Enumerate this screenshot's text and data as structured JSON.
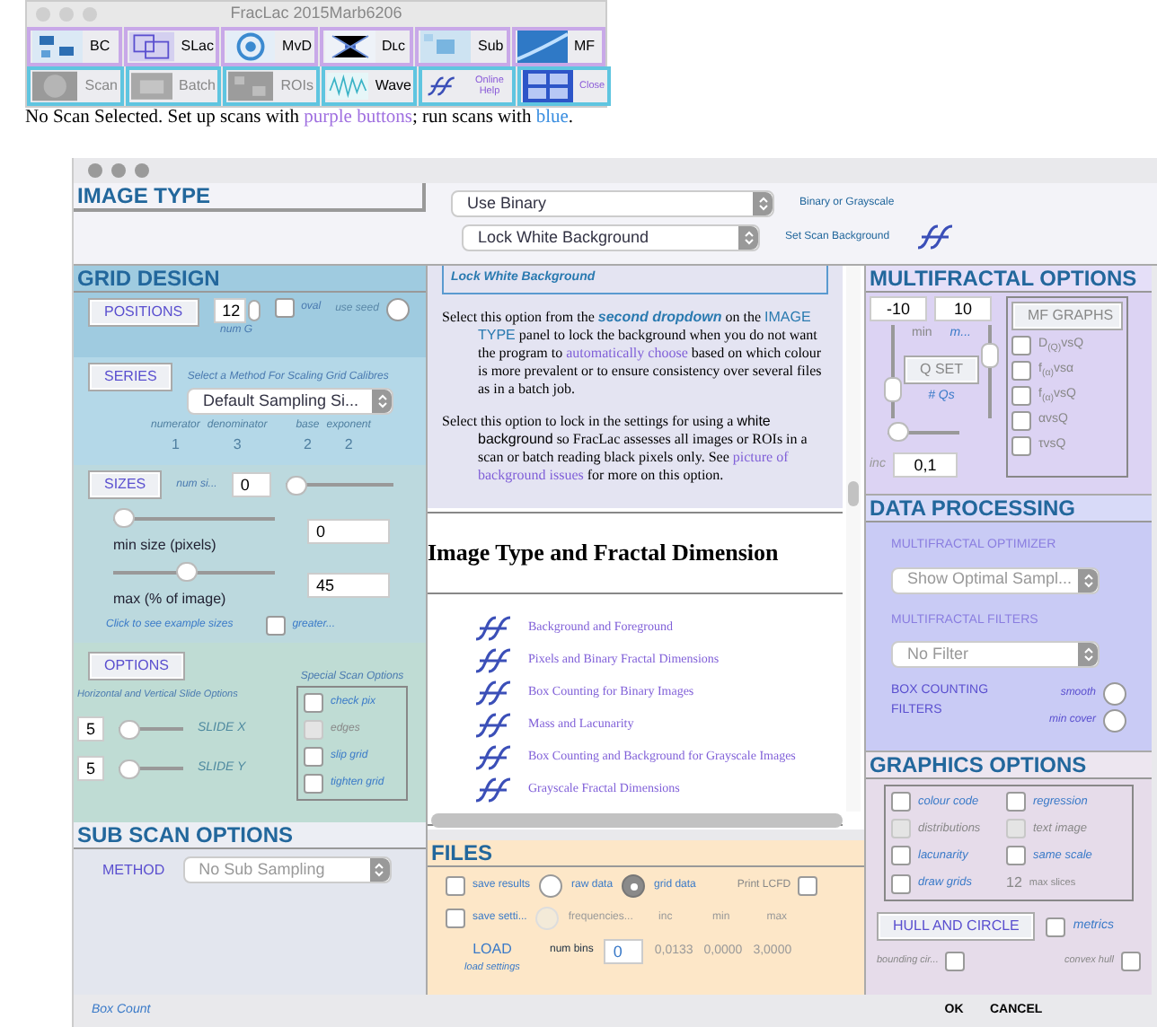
{
  "toolbar": {
    "title": "FracLac 2015Marb6206",
    "rows": [
      [
        {
          "label": "BC",
          "kind": "setup",
          "disabled": false
        },
        {
          "label": "SLac",
          "kind": "setup",
          "disabled": false
        },
        {
          "label": "MvD",
          "kind": "setup",
          "disabled": false
        },
        {
          "label": "Dʟc",
          "kind": "setup",
          "disabled": false
        },
        {
          "label": "Sub",
          "kind": "setup",
          "disabled": false
        },
        {
          "label": "MF",
          "kind": "setup",
          "disabled": false
        }
      ],
      [
        {
          "label": "Scan",
          "kind": "run",
          "disabled": true
        },
        {
          "label": "Batch",
          "kind": "run",
          "disabled": true
        },
        {
          "label": "ROIs",
          "kind": "run",
          "disabled": true
        },
        {
          "label": "Wave",
          "kind": "run",
          "disabled": false
        },
        {
          "label": "Online Help",
          "kind": "small",
          "disabled": false
        },
        {
          "label": "Close",
          "kind": "small",
          "disabled": false
        }
      ]
    ],
    "status": [
      {
        "text": "No Scan Selected. Set up scans with ",
        "kind": "plain"
      },
      {
        "text": "purple buttons",
        "kind": "setup"
      },
      {
        "text": "; run scans with ",
        "kind": "plain"
      },
      {
        "text": "blue",
        "kind": "run"
      },
      {
        "text": ".",
        "kind": "plain"
      }
    ]
  },
  "image_type": {
    "title": "IMAGE TYPE",
    "selects": [
      {
        "value": "Use Binary",
        "caption": "Binary or Grayscale"
      },
      {
        "value": "Lock White Background",
        "caption": "Set Scan Background"
      }
    ]
  },
  "grid_design": {
    "title": "GRID DESIGN",
    "positions": {
      "button": "POSITIONS",
      "value": "12",
      "caption": "num G",
      "oval": {
        "label": "oval",
        "checked": false
      },
      "use_seed": {
        "label": "use seed",
        "on": false
      }
    },
    "series": {
      "button": "SERIES",
      "caption": "Select a Method For Scaling Grid Calibres",
      "select": "Default Sampling Si...",
      "columns": [
        {
          "label": "numerator",
          "value": "1"
        },
        {
          "label": "denominator",
          "value": "3"
        },
        {
          "label": "base",
          "value": "2"
        },
        {
          "label": "exponent",
          "value": "2"
        }
      ]
    },
    "sizes": {
      "button": "SIZES",
      "num_label": "num si...",
      "num_value": "0",
      "num_slider": {
        "level": 0
      },
      "min": {
        "label": "min size (pixels)",
        "value": "0",
        "level": 0
      },
      "max": {
        "label": "max (% of image)",
        "value": "45",
        "level": 0.45
      },
      "link": "Click to see example sizes",
      "greater": {
        "label": "greater...",
        "checked": false
      }
    },
    "options": {
      "button": "OPTIONS",
      "caption": "Horizontal and Vertical Slide Options",
      "slides": [
        {
          "value": "5",
          "label": "SLIDE X",
          "level": 0
        },
        {
          "value": "5",
          "label": "SLIDE Y",
          "level": 0
        }
      ],
      "special_title": "Special Scan Options",
      "checks": [
        {
          "label": "check pix",
          "checked": false,
          "disabled": false
        },
        {
          "label": "edges",
          "checked": false,
          "disabled": true
        },
        {
          "label": "slip grid",
          "checked": false,
          "disabled": false
        },
        {
          "label": "tighten grid",
          "checked": false,
          "disabled": false
        }
      ]
    }
  },
  "sub_scan": {
    "title": "SUB SCAN OPTIONS",
    "method_label": "METHOD",
    "method": "No Sub Sampling"
  },
  "help": {
    "heading": "Lock White Background",
    "paragraphs": [
      [
        {
          "text": "Select this option from the ",
          "kind": "plain"
        },
        {
          "text": "second dropdown",
          "kind": "em"
        },
        {
          "text": " on the ",
          "kind": "plain"
        },
        {
          "text": "IMAGE TYPE",
          "kind": "term"
        },
        {
          "text": " panel to lock the background when you do not want the program to ",
          "kind": "plain"
        },
        {
          "text": "automatically choose",
          "kind": "link"
        },
        {
          "text": " based on which colour is more prevalent or to ensure consistency over several files as in a batch job.",
          "kind": "plain"
        }
      ],
      [
        {
          "text": "Select this option to lock in the settings for using a ",
          "kind": "plain"
        },
        {
          "text": "white background",
          "kind": "sans"
        },
        {
          "text": " so FracLac assesses all images or ROIs in a scan or batch reading black pixels only. See ",
          "kind": "plain"
        },
        {
          "text": "picture of background issues",
          "kind": "link"
        },
        {
          "text": " for more on this option.",
          "kind": "plain"
        }
      ]
    ],
    "section": "Image Type and Fractal Dimension",
    "links": [
      "Background and Foreground",
      "Pixels and Binary Fractal Dimensions",
      "Box Counting for Binary Images",
      "Mass and Lacunarity",
      "Box Counting and Background for Grayscale Images",
      "Grayscale Fractal Dimensions"
    ]
  },
  "files": {
    "title": "FILES",
    "save_results": {
      "label": "save results",
      "checked": false
    },
    "raw_data": {
      "label": "raw data",
      "selected": false
    },
    "grid_data": {
      "label": "grid data",
      "selected": true
    },
    "print_lcfd": {
      "label": "Print LCFD",
      "checked": false
    },
    "save_settings": {
      "label": "save setti...",
      "checked": false
    },
    "frequencies": {
      "label": "frequencies...",
      "selected": false
    },
    "headers": [
      "inc",
      "min",
      "max"
    ],
    "values": [
      "0,0133",
      "0,0000",
      "3,0000"
    ],
    "load": "LOAD",
    "load_caption": "load settings",
    "bins_label": "num bins",
    "bins": "0"
  },
  "multifractal": {
    "title": "MULTIFRACTAL OPTIONS",
    "q_min": "-10",
    "q_max": "10",
    "min_label": "min",
    "max_label": "m...",
    "qset": "Q SET",
    "qs_label": "# Qs",
    "sliders": {
      "min": {
        "level": 0.25
      },
      "max": {
        "level": 0.75
      },
      "qs": {
        "level": 0
      }
    },
    "inc_label": "inc",
    "inc": "0,1",
    "graphs_button": "MF GRAPHS",
    "graphs": [
      {
        "label": "D$_{(Q)}$vsQ",
        "checked": false
      },
      {
        "label": "f$_{(α)}$vsα",
        "checked": false
      },
      {
        "label": "f$_{(α)}$vsQ",
        "checked": false
      },
      {
        "label": "αvsQ",
        "checked": false
      },
      {
        "label": "τvsQ",
        "checked": false
      }
    ]
  },
  "data_processing": {
    "title": "DATA PROCESSING",
    "optimizer_label": "MULTIFRACTAL OPTIMIZER",
    "optimizer": "Show Optimal Sampl...",
    "filters_label": "MULTIFRACTAL FILTERS",
    "filter": "No Filter",
    "box_label": "BOX COUNTING FILTERS",
    "smooth": {
      "label": "smooth",
      "on": false
    },
    "min_cover": {
      "label": "min cover",
      "on": false
    }
  },
  "graphics": {
    "title": "GRAPHICS OPTIONS",
    "checks": [
      {
        "label": "colour code",
        "checked": false,
        "disabled": false
      },
      {
        "label": "regression",
        "checked": false,
        "disabled": false
      },
      {
        "label": "distributions",
        "checked": false,
        "disabled": true
      },
      {
        "label": "text image",
        "checked": false,
        "disabled": true
      },
      {
        "label": "lacunarity",
        "checked": false,
        "disabled": false
      },
      {
        "label": "same scale",
        "checked": false,
        "disabled": false
      },
      {
        "label": "draw grids",
        "checked": false,
        "disabled": false
      }
    ],
    "slices": "12",
    "slices_label": "max slices",
    "hull_button": "HULL AND CIRCLE",
    "metrics": {
      "label": "metrics",
      "checked": false
    },
    "bounding": {
      "label": "bounding cir...",
      "checked": false
    },
    "convex": {
      "label": "convex hull",
      "checked": false
    }
  },
  "footer": {
    "mode": "Box Count",
    "ok": "OK",
    "cancel": "CANCEL"
  }
}
